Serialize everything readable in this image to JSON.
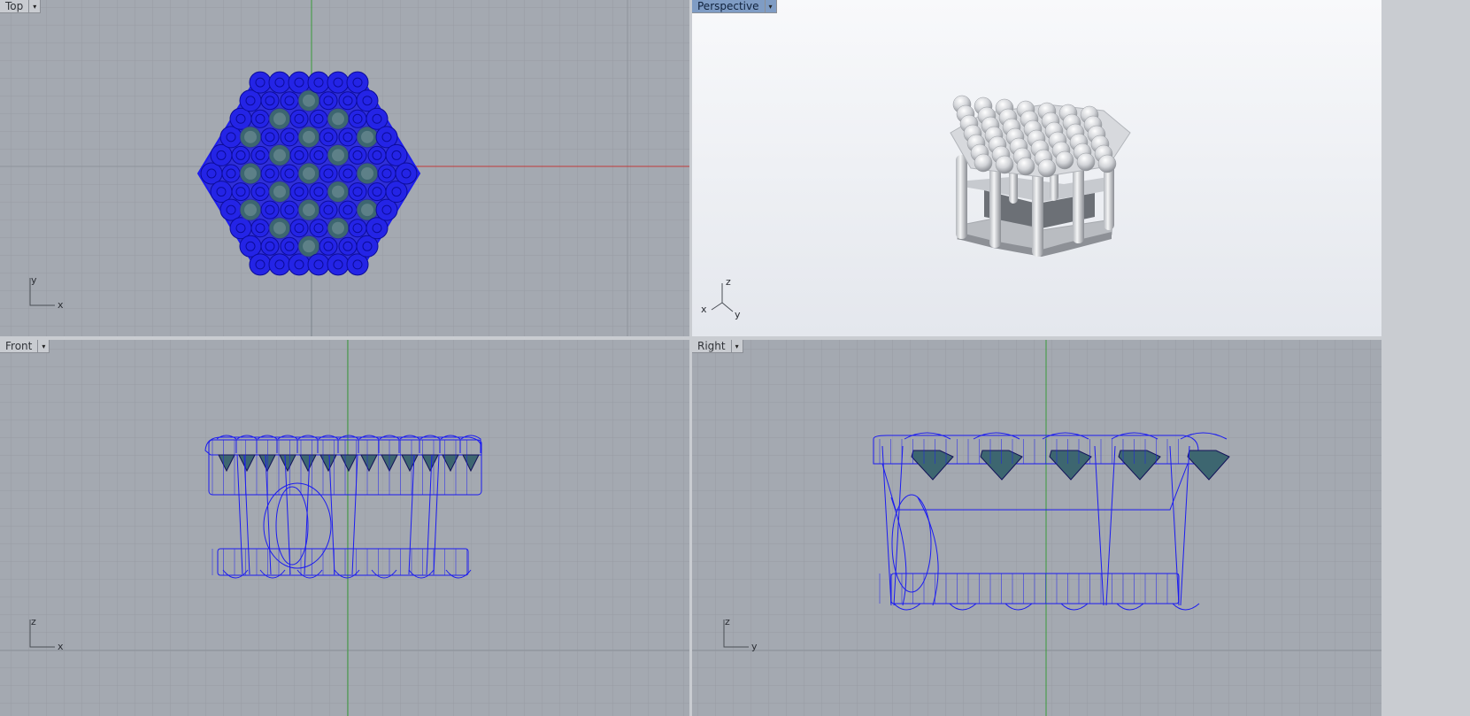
{
  "viewports": {
    "top": {
      "title": "Top",
      "axis_x": "x",
      "axis_y": "y"
    },
    "perspective": {
      "title": "Perspective",
      "axis_x": "x",
      "axis_y": "y",
      "axis_z": "z"
    },
    "front": {
      "title": "Front",
      "axis_x": "x",
      "axis_z": "z"
    },
    "right": {
      "title": "Right",
      "axis_y": "y",
      "axis_z": "z"
    }
  },
  "dropdown_glyph": "▾",
  "colors": {
    "grid_bg": "#a4a9b1",
    "grid_line": "#979ca4",
    "grid_major": "#8e939b",
    "x_axis": "#c03a3a",
    "y_axis": "#3a9a3a",
    "wire": "#1c1cf0",
    "gem": "#3d6670",
    "perspective_bg_top": "#f8f9fb",
    "perspective_bg_bottom": "#e4e7ed",
    "active_label": "#7f9cc4"
  }
}
